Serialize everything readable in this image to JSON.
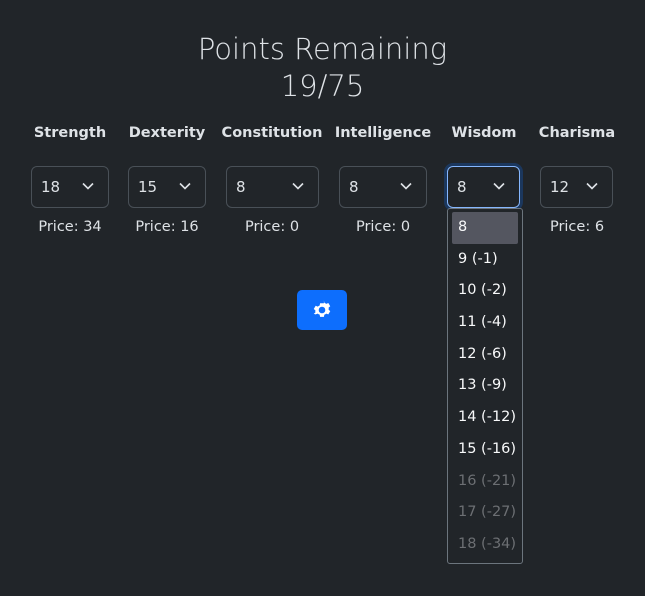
{
  "header": {
    "title": "Points Remaining",
    "points": "19/75"
  },
  "stats": [
    {
      "name": "Strength",
      "value": "18",
      "price": "Price: 34"
    },
    {
      "name": "Dexterity",
      "value": "15",
      "price": "Price: 16"
    },
    {
      "name": "Constitution",
      "value": "8",
      "price": "Price: 0"
    },
    {
      "name": "Intelligence",
      "value": "8",
      "price": "Price: 0"
    },
    {
      "name": "Wisdom",
      "value": "8",
      "price": ""
    },
    {
      "name": "Charisma",
      "value": "12",
      "price": "Price: 6"
    }
  ],
  "settings_icon": "gear-icon",
  "accent": "#0d6efd",
  "dropdown": {
    "options": [
      {
        "label": "8",
        "highlighted": true,
        "disabled": false
      },
      {
        "label": "9 (-1)",
        "disabled": false
      },
      {
        "label": "10 (-2)",
        "disabled": false
      },
      {
        "label": "11 (-4)",
        "disabled": false
      },
      {
        "label": "12 (-6)",
        "disabled": false
      },
      {
        "label": "13 (-9)",
        "disabled": false
      },
      {
        "label": "14 (-12)",
        "disabled": false
      },
      {
        "label": "15 (-16)",
        "disabled": false
      },
      {
        "label": "16 (-21)",
        "disabled": true
      },
      {
        "label": "17 (-27)",
        "disabled": true
      },
      {
        "label": "18 (-34)",
        "disabled": true
      }
    ]
  }
}
